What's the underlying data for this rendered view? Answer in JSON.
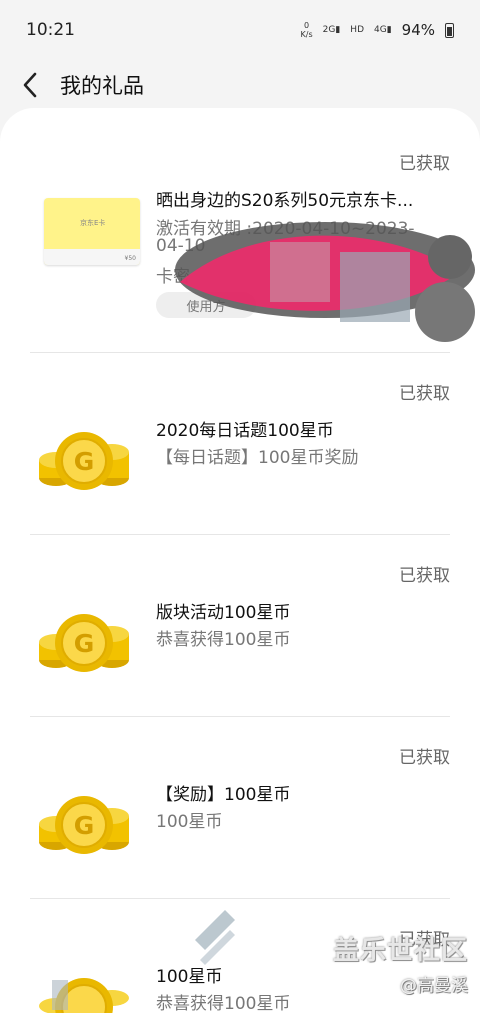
{
  "status_bar": {
    "time": "10:21",
    "net_speed_top": "0",
    "net_speed_unit": "K/s",
    "signal1": "2G",
    "hd": "HD",
    "signal2": "4G",
    "battery": "94%"
  },
  "header": {
    "title": "我的礼品"
  },
  "gifts": [
    {
      "status": "已获取",
      "name": "晒出身边的S20系列50元京东卡...",
      "desc1": "激活有效期 :2020-04-10~2023-",
      "desc2": "04-10",
      "desc3": "卡密",
      "button": "使用方",
      "card_text": "京东E卡",
      "card_value": "¥50"
    },
    {
      "status": "已获取",
      "name": "2020每日话题100星币",
      "desc": "【每日话题】100星币奖励"
    },
    {
      "status": "已获取",
      "name": "版块活动100星币",
      "desc": "恭喜获得100星币"
    },
    {
      "status": "已获取",
      "name": "【奖励】100星币",
      "desc": "100星币"
    },
    {
      "status": "已获取",
      "name": "100星币",
      "desc": "恭喜获得100星币"
    }
  ],
  "watermark": {
    "line1": "盖乐世社区",
    "line2": "@高曼溪"
  },
  "colors": {
    "coin": "#f2c200",
    "coin_dark": "#d8a600",
    "accent_status": "#666666"
  }
}
